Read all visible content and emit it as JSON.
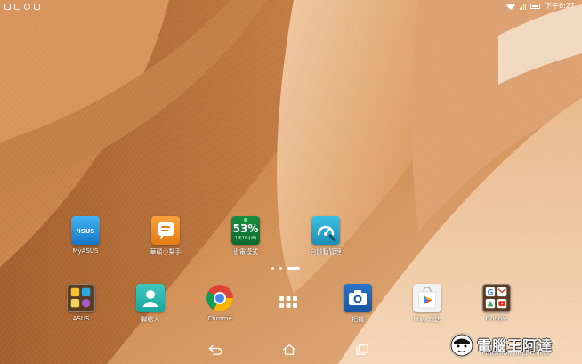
{
  "status_bar": {
    "left_icons": [
      "notification-icon",
      "screenshot-icon",
      "sync-icon",
      "storage-icon"
    ],
    "right_icons": [
      "wifi-icon",
      "signal-icon",
      "battery-icon"
    ],
    "time": "下午6:27"
  },
  "home_apps": [
    {
      "id": "myasus",
      "label": "MyASUS",
      "icon": "myasus-icon",
      "color": "#1f8fd6"
    },
    {
      "id": "asus-helper",
      "label": "華碩小幫手",
      "icon": "chat-bubble-icon",
      "color": "#ef8a1c"
    },
    {
      "id": "power-saver",
      "label": "省電模式",
      "icon": "battery-saver-icon",
      "color": "#0f7a36",
      "percent": "53%",
      "subtext": "1天16小時"
    },
    {
      "id": "autostart",
      "label": "自啟動管理",
      "icon": "gauge-icon",
      "color": "#2aa6c9"
    }
  ],
  "page_indicator": {
    "count": 3,
    "active": 2
  },
  "dock_apps": [
    {
      "id": "asus-folder",
      "label": "ASUS",
      "icon": "folder-icon"
    },
    {
      "id": "contacts",
      "label": "聯絡人",
      "icon": "contacts-icon"
    },
    {
      "id": "chrome",
      "label": "Chrome",
      "icon": "chrome-icon"
    },
    {
      "id": "app-drawer",
      "label": "",
      "icon": "app-drawer-icon"
    },
    {
      "id": "camera",
      "label": "相機",
      "icon": "camera-icon"
    },
    {
      "id": "play-store",
      "label": "Play 商店",
      "icon": "play-store-icon"
    },
    {
      "id": "google",
      "label": "Google",
      "icon": "google-folder-icon"
    }
  ],
  "nav_bar": {
    "buttons": [
      "back-icon",
      "home-icon",
      "recents-icon"
    ]
  },
  "watermark": {
    "text": "電腦王阿達",
    "url": "http://www.kocpc.com.tw"
  }
}
